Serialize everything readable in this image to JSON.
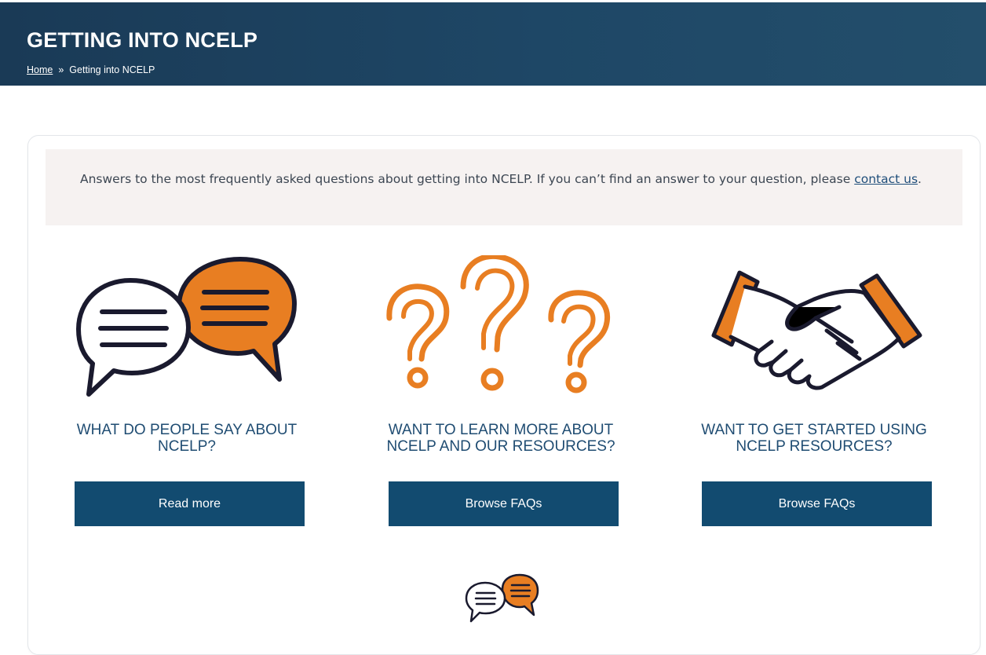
{
  "page": {
    "title": "GETTING INTO NCELP",
    "breadcrumb": {
      "home": "Home",
      "separator": "»",
      "current": "Getting into NCELP"
    }
  },
  "intro": {
    "text_before": "Answers to the most frequently asked questions about getting into NCELP. If you can’t find an answer to your question, please ",
    "link": "contact us",
    "text_after": "."
  },
  "columns": [
    {
      "heading": "WHAT DO PEOPLE SAY ABOUT NCELP?",
      "button": "Read more",
      "icon": "speech-bubbles-icon"
    },
    {
      "heading": "WANT TO LEARN MORE ABOUT NCELP AND OUR RESOURCES?",
      "button": "Browse FAQs",
      "icon": "question-marks-icon"
    },
    {
      "heading": "WANT TO GET STARTED USING NCELP RESOURCES?",
      "button": "Browse FAQs",
      "icon": "handshake-icon"
    }
  ],
  "colors": {
    "header_bg": "#1e4766",
    "accent_orange": "#e87e22",
    "button_bg": "#124b70",
    "heading_text": "#1f4c72",
    "intro_bg": "#f6f2f1"
  }
}
